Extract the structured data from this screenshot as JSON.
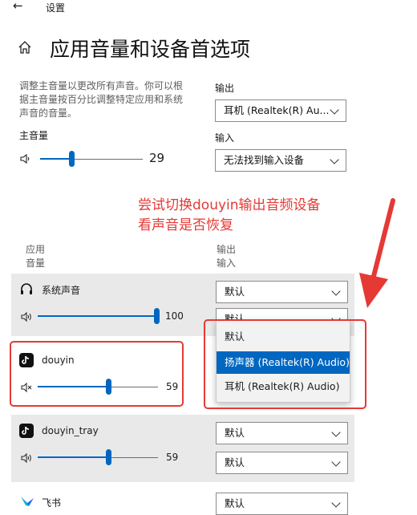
{
  "window": {
    "back_label": "←",
    "title": "设置"
  },
  "header": {
    "home_icon": "home-icon",
    "title": "应用音量和设备首选项"
  },
  "intro": {
    "description_lines": [
      "调整主音量以更改所有声音。你可以根",
      "据主音量按百分比调整特定应用和系统",
      "声音的音量。"
    ]
  },
  "master": {
    "label": "主音量",
    "value": "29",
    "level_percent": 29,
    "icon": "speaker-icon"
  },
  "output": {
    "label": "输出",
    "selected": "耳机 (Realtek(R) Au..."
  },
  "input": {
    "label": "输入",
    "selected": "无法找到输入设备"
  },
  "annotation": {
    "lines": [
      "尝试切换douyin输出音频设备",
      "看声音是否恢复"
    ],
    "color": "#e53935"
  },
  "columns": {
    "left": [
      "应用",
      "音量"
    ],
    "right": [
      "输出",
      "输入"
    ]
  },
  "apps": [
    {
      "name": "系统声音",
      "icon": "headphones-icon",
      "volume": "100",
      "level_percent": 100,
      "muted": false,
      "output": "默认",
      "input": "默认"
    },
    {
      "name": "douyin",
      "icon": "tiktok-icon",
      "volume": "59",
      "level_percent": 59,
      "muted": true
    },
    {
      "name": "douyin_tray",
      "icon": "tiktok-icon",
      "volume": "59",
      "level_percent": 59,
      "muted": false,
      "output": "默认",
      "input": "默认"
    },
    {
      "name": "飞书",
      "icon": "feishu-icon",
      "output": "默认"
    }
  ],
  "dropdown_menu": {
    "items": [
      "默认",
      "扬声器 (Realtek(R) Audio)",
      "耳机 (Realtek(R) Audio)"
    ],
    "selected_index": 1
  },
  "colors": {
    "accent": "#0067c0",
    "highlight": "#e53935",
    "row_bg": "#e9e9e9"
  }
}
